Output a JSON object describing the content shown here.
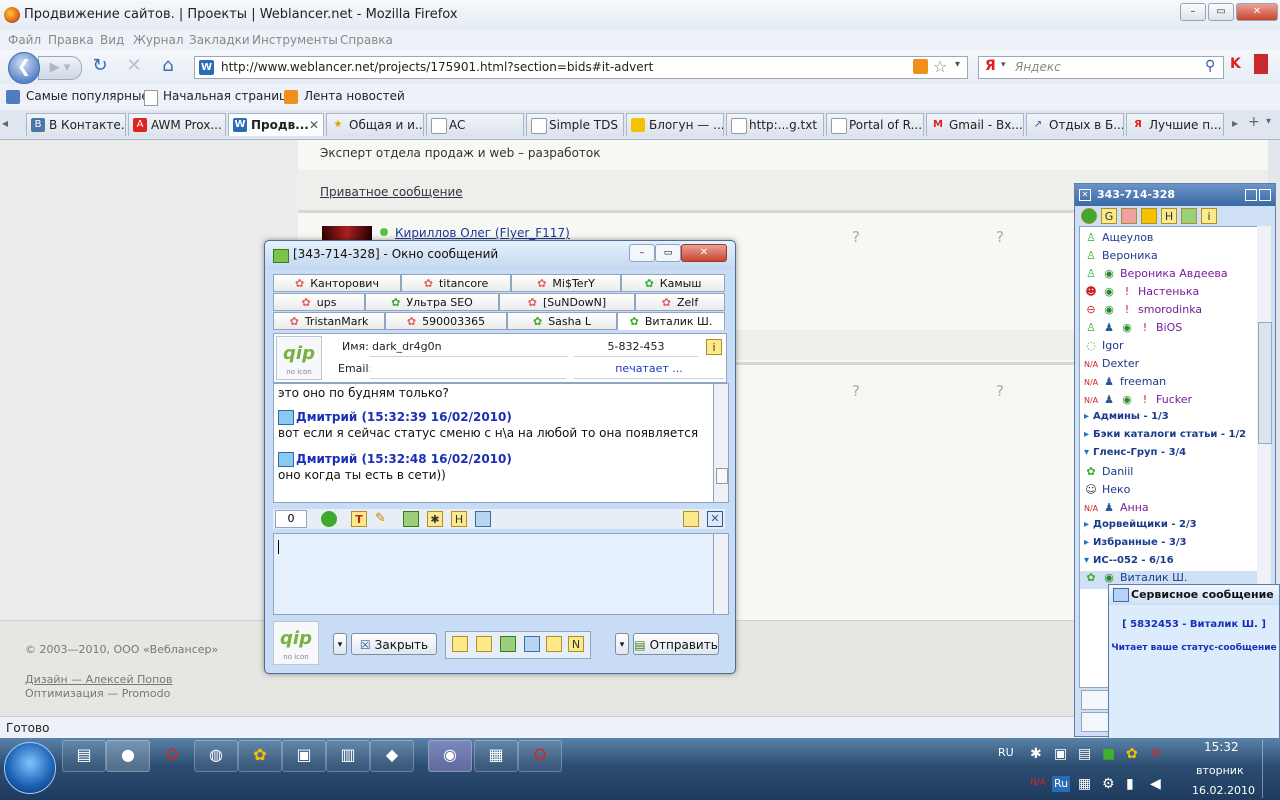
{
  "browser": {
    "title": "Продвижение сайтов. | Проекты | Weblancer.net - Mozilla Firefox",
    "menu": [
      "Файл",
      "Правка",
      "Вид",
      "Журнал",
      "Закладки",
      "Инструменты",
      "Справка"
    ],
    "url": "http://www.weblancer.net/projects/175901.html?section=bids#it-advert",
    "search_placeholder": "Яндекс",
    "bookmarks": [
      "Самые популярные",
      "Начальная страница",
      "Лента новостей"
    ],
    "tabs": [
      "В Контакте...",
      "AWM Prox...",
      "Продв...",
      "Общая и и...",
      "AC",
      "Simple TDS",
      "Блогун — ...",
      "http:...g.txt",
      "Portal of R...",
      "Gmail - Вх...",
      "Отдых в Б...",
      "Лучшие п..."
    ],
    "status": "Готово"
  },
  "page": {
    "expert_line": "Эксперт отдела продаж и web – разработок",
    "private_msg": "Приватное сообщение",
    "user_link": "Кириллов Олег (Flyer_F117)",
    "qmark": "?",
    "footer": {
      "copyright": "© 2003—2010, ООО «Веблансер»",
      "design": "Дизайн — Алексей Попов",
      "optimization": "Оптимизация — Promodo"
    }
  },
  "msgwin": {
    "title": "[343-714-328] - Окно сообщений",
    "contact_tabs": [
      [
        "Канторович",
        "titancore",
        "Mi$TerY",
        "Камыш"
      ],
      [
        "ups",
        "Ультра SEO",
        "[SuNDowN]",
        "Zelf"
      ],
      [
        "TristanMark",
        "590003365",
        "Sasha L",
        "Виталик Ш."
      ]
    ],
    "name_label": "Имя:",
    "name_value": "dark_dr4g0n",
    "uin_value": "5-832-453",
    "email_label": "Email:",
    "typing": "печатает ...",
    "logo_text": "qip",
    "logo_sub": "no icon",
    "chat": [
      {
        "type": "text",
        "text": "это оно по будням только?"
      },
      {
        "type": "author",
        "text": "Дмитрий (15:32:39 16/02/2010)"
      },
      {
        "type": "text",
        "text": "вот если я сейчас статус сменю с н\\а на любой то она появляется"
      },
      {
        "type": "author",
        "text": "Дмитрий (15:32:48 16/02/2010)"
      },
      {
        "type": "text",
        "text": "оно когда ты есть в сети))"
      }
    ],
    "counter": "0",
    "close_label": "Закрыть",
    "send_label": "Отправить"
  },
  "clist": {
    "title": "343-714-328",
    "contacts": [
      {
        "name": "Ащеулов",
        "kind": "contact"
      },
      {
        "name": "Вероника",
        "kind": "contact"
      },
      {
        "name": "Вероника Авдеева",
        "kind": "contact"
      },
      {
        "name": "Настенька",
        "kind": "contact"
      },
      {
        "name": "smorodinka",
        "kind": "contact"
      },
      {
        "name": "BiOS",
        "kind": "contact"
      },
      {
        "name": "Igor",
        "kind": "contact"
      },
      {
        "name": "Dexter",
        "kind": "contact"
      },
      {
        "name": "freeman",
        "kind": "contact"
      },
      {
        "name": "Fucker",
        "kind": "contact"
      },
      {
        "name": "Админы - 1/3",
        "kind": "group"
      },
      {
        "name": "Бэки каталоги статьи - 1/2",
        "kind": "group"
      },
      {
        "name": "Гленс-Груп - 3/4",
        "kind": "group"
      },
      {
        "name": "Daniil",
        "kind": "contact"
      },
      {
        "name": "Неко",
        "kind": "contact"
      },
      {
        "name": "Анна",
        "kind": "contact"
      },
      {
        "name": "Дорвейщики - 2/3",
        "kind": "group"
      },
      {
        "name": "Избранные - 3/3",
        "kind": "group"
      },
      {
        "name": "ИС--052 - 6/16",
        "kind": "group"
      },
      {
        "name": "Виталик Ш.",
        "kind": "contact"
      }
    ]
  },
  "popup": {
    "title": "Сервисное сообщение",
    "line1": "[ 5832453 - Виталик Ш. ]",
    "line2": "Читает ваше статус-сообщение"
  },
  "taskbar": {
    "lang": "RU",
    "time": "15:32",
    "day": "вторник",
    "date": "16.02.2010",
    "lang2": "Ru"
  }
}
